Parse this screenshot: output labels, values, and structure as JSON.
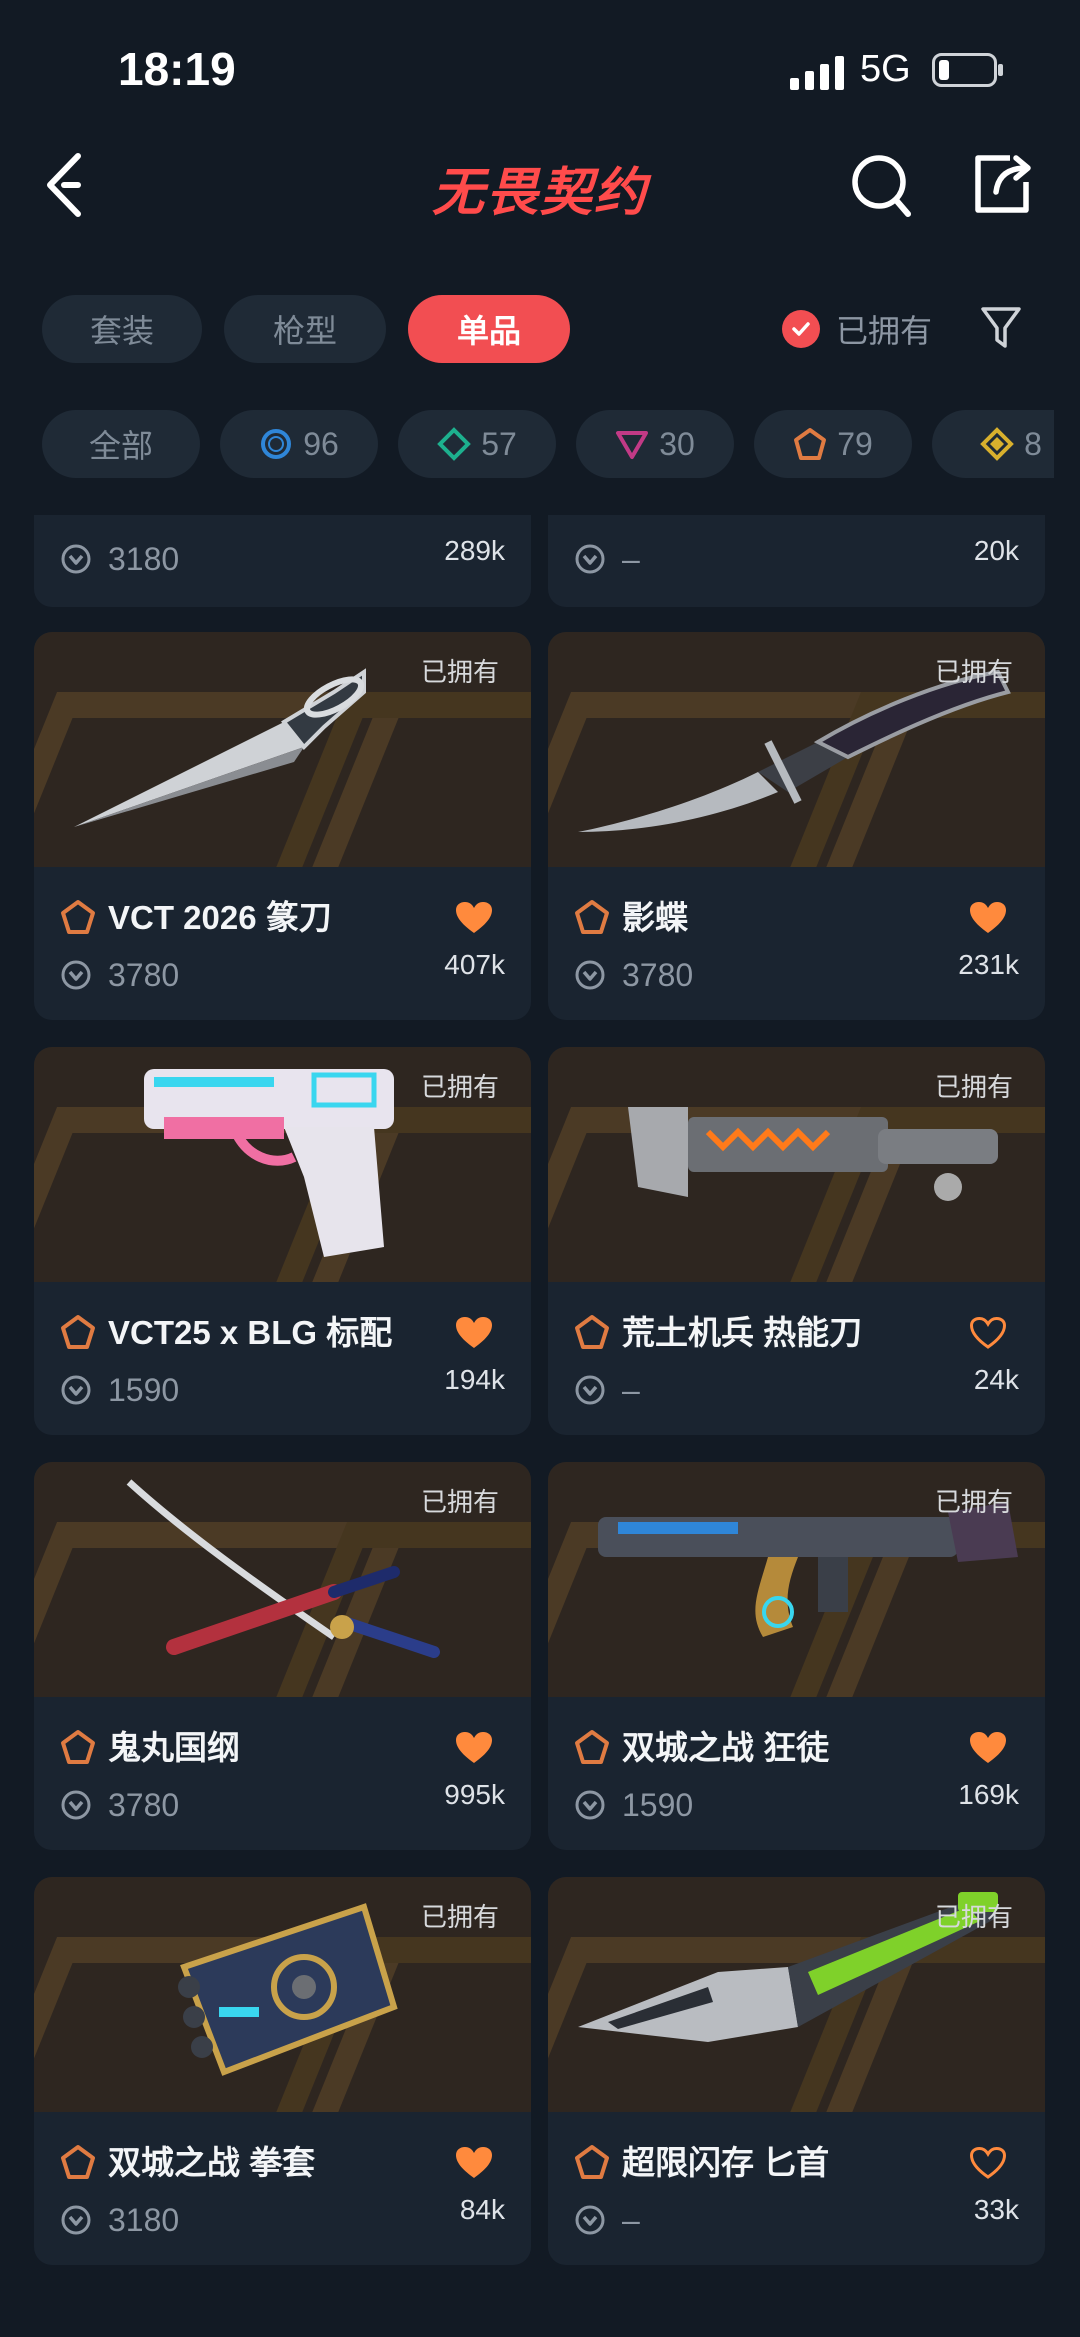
{
  "status_bar": {
    "time": "18:19",
    "network": "5G"
  },
  "header": {
    "logo": "无畏契约"
  },
  "tabs": [
    {
      "label": "套装",
      "active": false
    },
    {
      "label": "枪型",
      "active": false
    },
    {
      "label": "单品",
      "active": true
    }
  ],
  "owned_filter": {
    "label": "已拥有",
    "checked": true
  },
  "chips": [
    {
      "label": "全部",
      "count": ""
    },
    {
      "label": "",
      "count": "96",
      "color": "#2f86d8",
      "icon": "circle-tier-icon"
    },
    {
      "label": "",
      "count": "57",
      "color": "#1db08e",
      "icon": "diamond-tier-icon"
    },
    {
      "label": "",
      "count": "30",
      "color": "#c23a86",
      "icon": "triangle-tier-icon"
    },
    {
      "label": "",
      "count": "79",
      "color": "#e07b42",
      "icon": "pentagon-tier-icon"
    },
    {
      "label": "",
      "count": "8",
      "color": "#d8b02d",
      "icon": "diamond-gold-tier-icon"
    }
  ],
  "items": [
    {
      "name": "",
      "price": "3180",
      "likes": "289k",
      "owned_label": "",
      "liked": true
    },
    {
      "name": "",
      "price": "–",
      "likes": "20k",
      "owned_label": "",
      "liked": true
    },
    {
      "name": "VCT 2026 篆刀",
      "price": "3780",
      "likes": "407k",
      "owned_label": "已拥有",
      "liked": true,
      "weapon": "knife"
    },
    {
      "name": "影蝶",
      "price": "3780",
      "likes": "231k",
      "owned_label": "已拥有",
      "liked": true,
      "weapon": "butterfly-knife"
    },
    {
      "name": "VCT25 x BLG 标配",
      "price": "1590",
      "likes": "194k",
      "owned_label": "已拥有",
      "liked": true,
      "weapon": "pistol"
    },
    {
      "name": "荒土机兵 热能刀",
      "price": "–",
      "likes": "24k",
      "owned_label": "已拥有",
      "liked": false,
      "weapon": "thermal-blade"
    },
    {
      "name": "鬼丸国纲",
      "price": "3780",
      "likes": "995k",
      "owned_label": "已拥有",
      "liked": true,
      "weapon": "katana"
    },
    {
      "name": "双城之战 狂徒",
      "price": "1590",
      "likes": "169k",
      "owned_label": "已拥有",
      "liked": true,
      "weapon": "rifle"
    },
    {
      "name": "双城之战 拳套",
      "price": "3180",
      "likes": "84k",
      "owned_label": "已拥有",
      "liked": true,
      "weapon": "gauntlet"
    },
    {
      "name": "超限闪存 匕首",
      "price": "–",
      "likes": "33k",
      "owned_label": "已拥有",
      "liked": false,
      "weapon": "dagger"
    }
  ],
  "colors": {
    "accent": "#f24e52",
    "heart": "#ff8a3d",
    "tier": "#e07b42",
    "background": "#121a24"
  }
}
